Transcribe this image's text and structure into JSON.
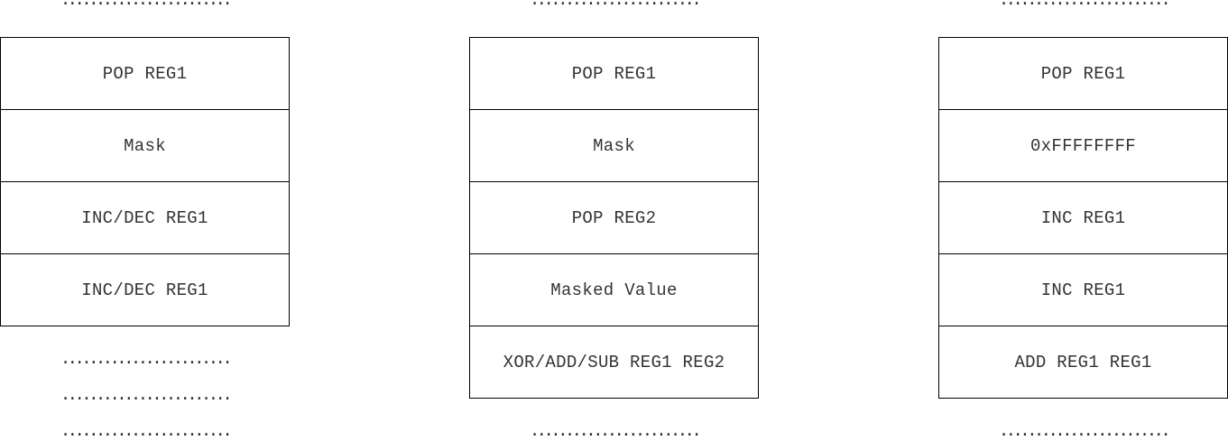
{
  "ellipsis": "........................",
  "stacks": [
    {
      "cells": [
        "POP REG1",
        "Mask",
        "INC/DEC REG1",
        "INC/DEC REG1"
      ]
    },
    {
      "cells": [
        "POP REG1",
        "Mask",
        "POP REG2",
        "Masked Value",
        "XOR/ADD/SUB REG1 REG2"
      ]
    },
    {
      "cells": [
        "POP REG1",
        "0xFFFFFFFF",
        "INC REG1",
        "INC REG1",
        "ADD REG1 REG1"
      ]
    }
  ]
}
